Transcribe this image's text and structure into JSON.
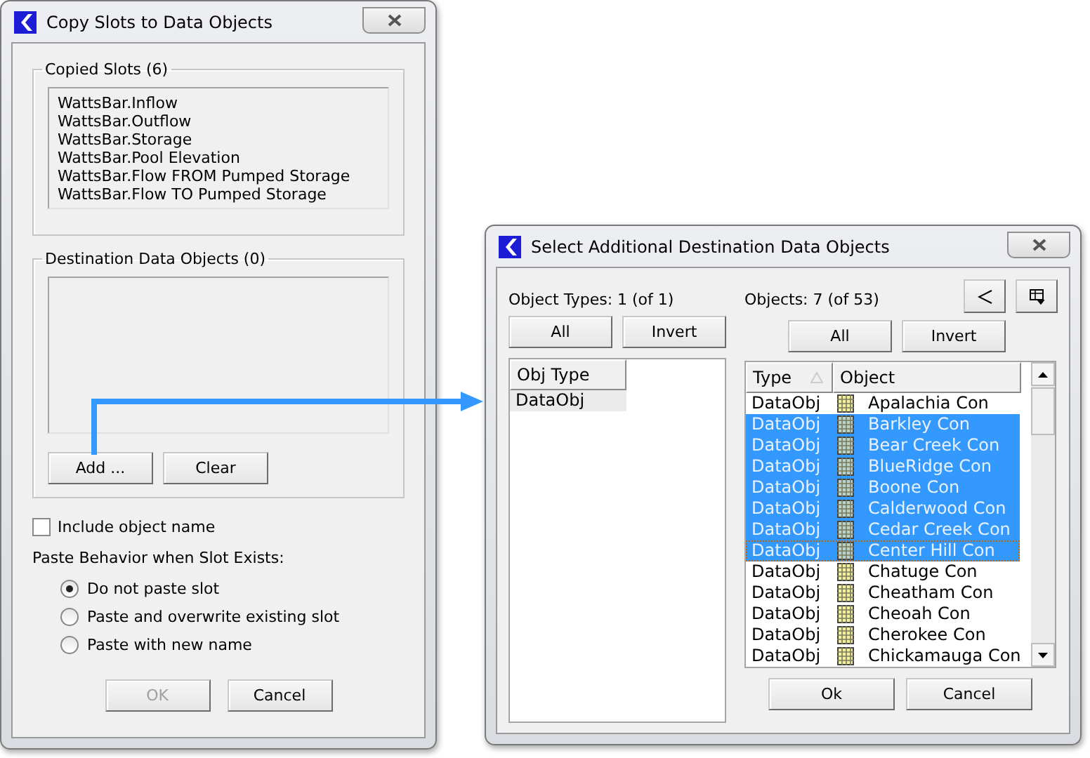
{
  "copy_dialog": {
    "title": "Copy Slots to Data Objects",
    "copied_slots": {
      "label": "Copied Slots (6)",
      "items": [
        "WattsBar.Inflow",
        "WattsBar.Outflow",
        "WattsBar.Storage",
        "WattsBar.Pool Elevation",
        "WattsBar.Flow FROM Pumped Storage",
        "WattsBar.Flow TO Pumped Storage"
      ]
    },
    "destination": {
      "label": "Destination Data Objects (0)",
      "buttons": [
        "Add ...",
        "Clear"
      ]
    },
    "include_object_name": {
      "label": "Include object name",
      "checked": false
    },
    "paste_behavior": {
      "label": "Paste Behavior when Slot Exists:",
      "options": [
        {
          "label": "Do not paste slot",
          "selected": true
        },
        {
          "label": "Paste and overwrite existing slot",
          "selected": false
        },
        {
          "label": "Paste with new name",
          "selected": false
        }
      ]
    },
    "buttons": [
      {
        "label": "OK",
        "disabled": true
      },
      {
        "label": "Cancel",
        "disabled": false
      }
    ]
  },
  "select_dialog": {
    "title": "Select Additional Destination Data Objects",
    "object_types": {
      "label": "Object Types: 1 (of 1)",
      "buttons": [
        "All",
        "Invert"
      ],
      "column": "Obj Type",
      "rows": [
        "DataObj"
      ]
    },
    "objects": {
      "label": "Objects: 7 (of 53)",
      "buttons": [
        "All",
        "Invert"
      ],
      "columns": [
        "Type",
        "Object"
      ],
      "rows": [
        {
          "type": "DataObj",
          "name": "Apalachia Con",
          "selected": false,
          "focused": false
        },
        {
          "type": "DataObj",
          "name": "Barkley Con",
          "selected": true,
          "focused": false
        },
        {
          "type": "DataObj",
          "name": "Bear Creek Con",
          "selected": true,
          "focused": false
        },
        {
          "type": "DataObj",
          "name": "BlueRidge Con",
          "selected": true,
          "focused": false
        },
        {
          "type": "DataObj",
          "name": "Boone Con",
          "selected": true,
          "focused": false
        },
        {
          "type": "DataObj",
          "name": "Calderwood Con",
          "selected": true,
          "focused": false
        },
        {
          "type": "DataObj",
          "name": "Cedar Creek Con",
          "selected": true,
          "focused": false
        },
        {
          "type": "DataObj",
          "name": "Center Hill Con",
          "selected": true,
          "focused": true
        },
        {
          "type": "DataObj",
          "name": "Chatuge Con",
          "selected": false,
          "focused": false
        },
        {
          "type": "DataObj",
          "name": "Cheatham Con",
          "selected": false,
          "focused": false
        },
        {
          "type": "DataObj",
          "name": "Cheoah Con",
          "selected": false,
          "focused": false
        },
        {
          "type": "DataObj",
          "name": "Cherokee Con",
          "selected": false,
          "focused": false
        },
        {
          "type": "DataObj",
          "name": "Chickamauga Con",
          "selected": false,
          "focused": false
        }
      ]
    },
    "buttons": [
      "Ok",
      "Cancel"
    ]
  }
}
